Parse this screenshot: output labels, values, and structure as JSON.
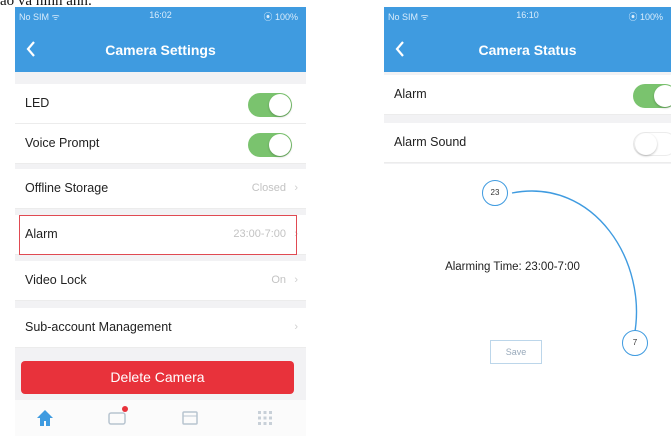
{
  "caption": "ảo và hình ảnh:",
  "left_screen": {
    "status": {
      "carrier": "No SIM ᯤ",
      "time": "16:02",
      "battery": "⦿ 100%"
    },
    "title": "Camera Settings",
    "rows": [
      {
        "label": "LED",
        "toggle": "on"
      },
      {
        "label": "Voice Prompt",
        "toggle": "on"
      },
      {
        "label": "Offline Storage",
        "value": "Closed"
      },
      {
        "label": "Alarm",
        "value": "23:00-7:00",
        "highlighted": true
      },
      {
        "label": "Video Lock",
        "value": "On"
      },
      {
        "label": "Sub-account Management",
        "value": ""
      }
    ],
    "delete_label": "Delete Camera",
    "tabs": [
      "home-icon",
      "message-icon",
      "devices-icon",
      "more-grid-icon"
    ]
  },
  "right_screen": {
    "status": {
      "carrier": "No SIM ᯤ",
      "time": "16:10",
      "battery": "⦿ 100%"
    },
    "title": "Camera Status",
    "rows": [
      {
        "label": "Alarm",
        "toggle": "on"
      },
      {
        "label": "Alarm Sound",
        "toggle": "off"
      }
    ],
    "start_time": "23",
    "end_time": "7",
    "alarming_time": "Alarming Time: 23:00-7:00",
    "save_label": "Save"
  },
  "colors": {
    "accent": "#3f9be0",
    "toggle_on": "#7ac36e",
    "danger": "#e8323b"
  }
}
